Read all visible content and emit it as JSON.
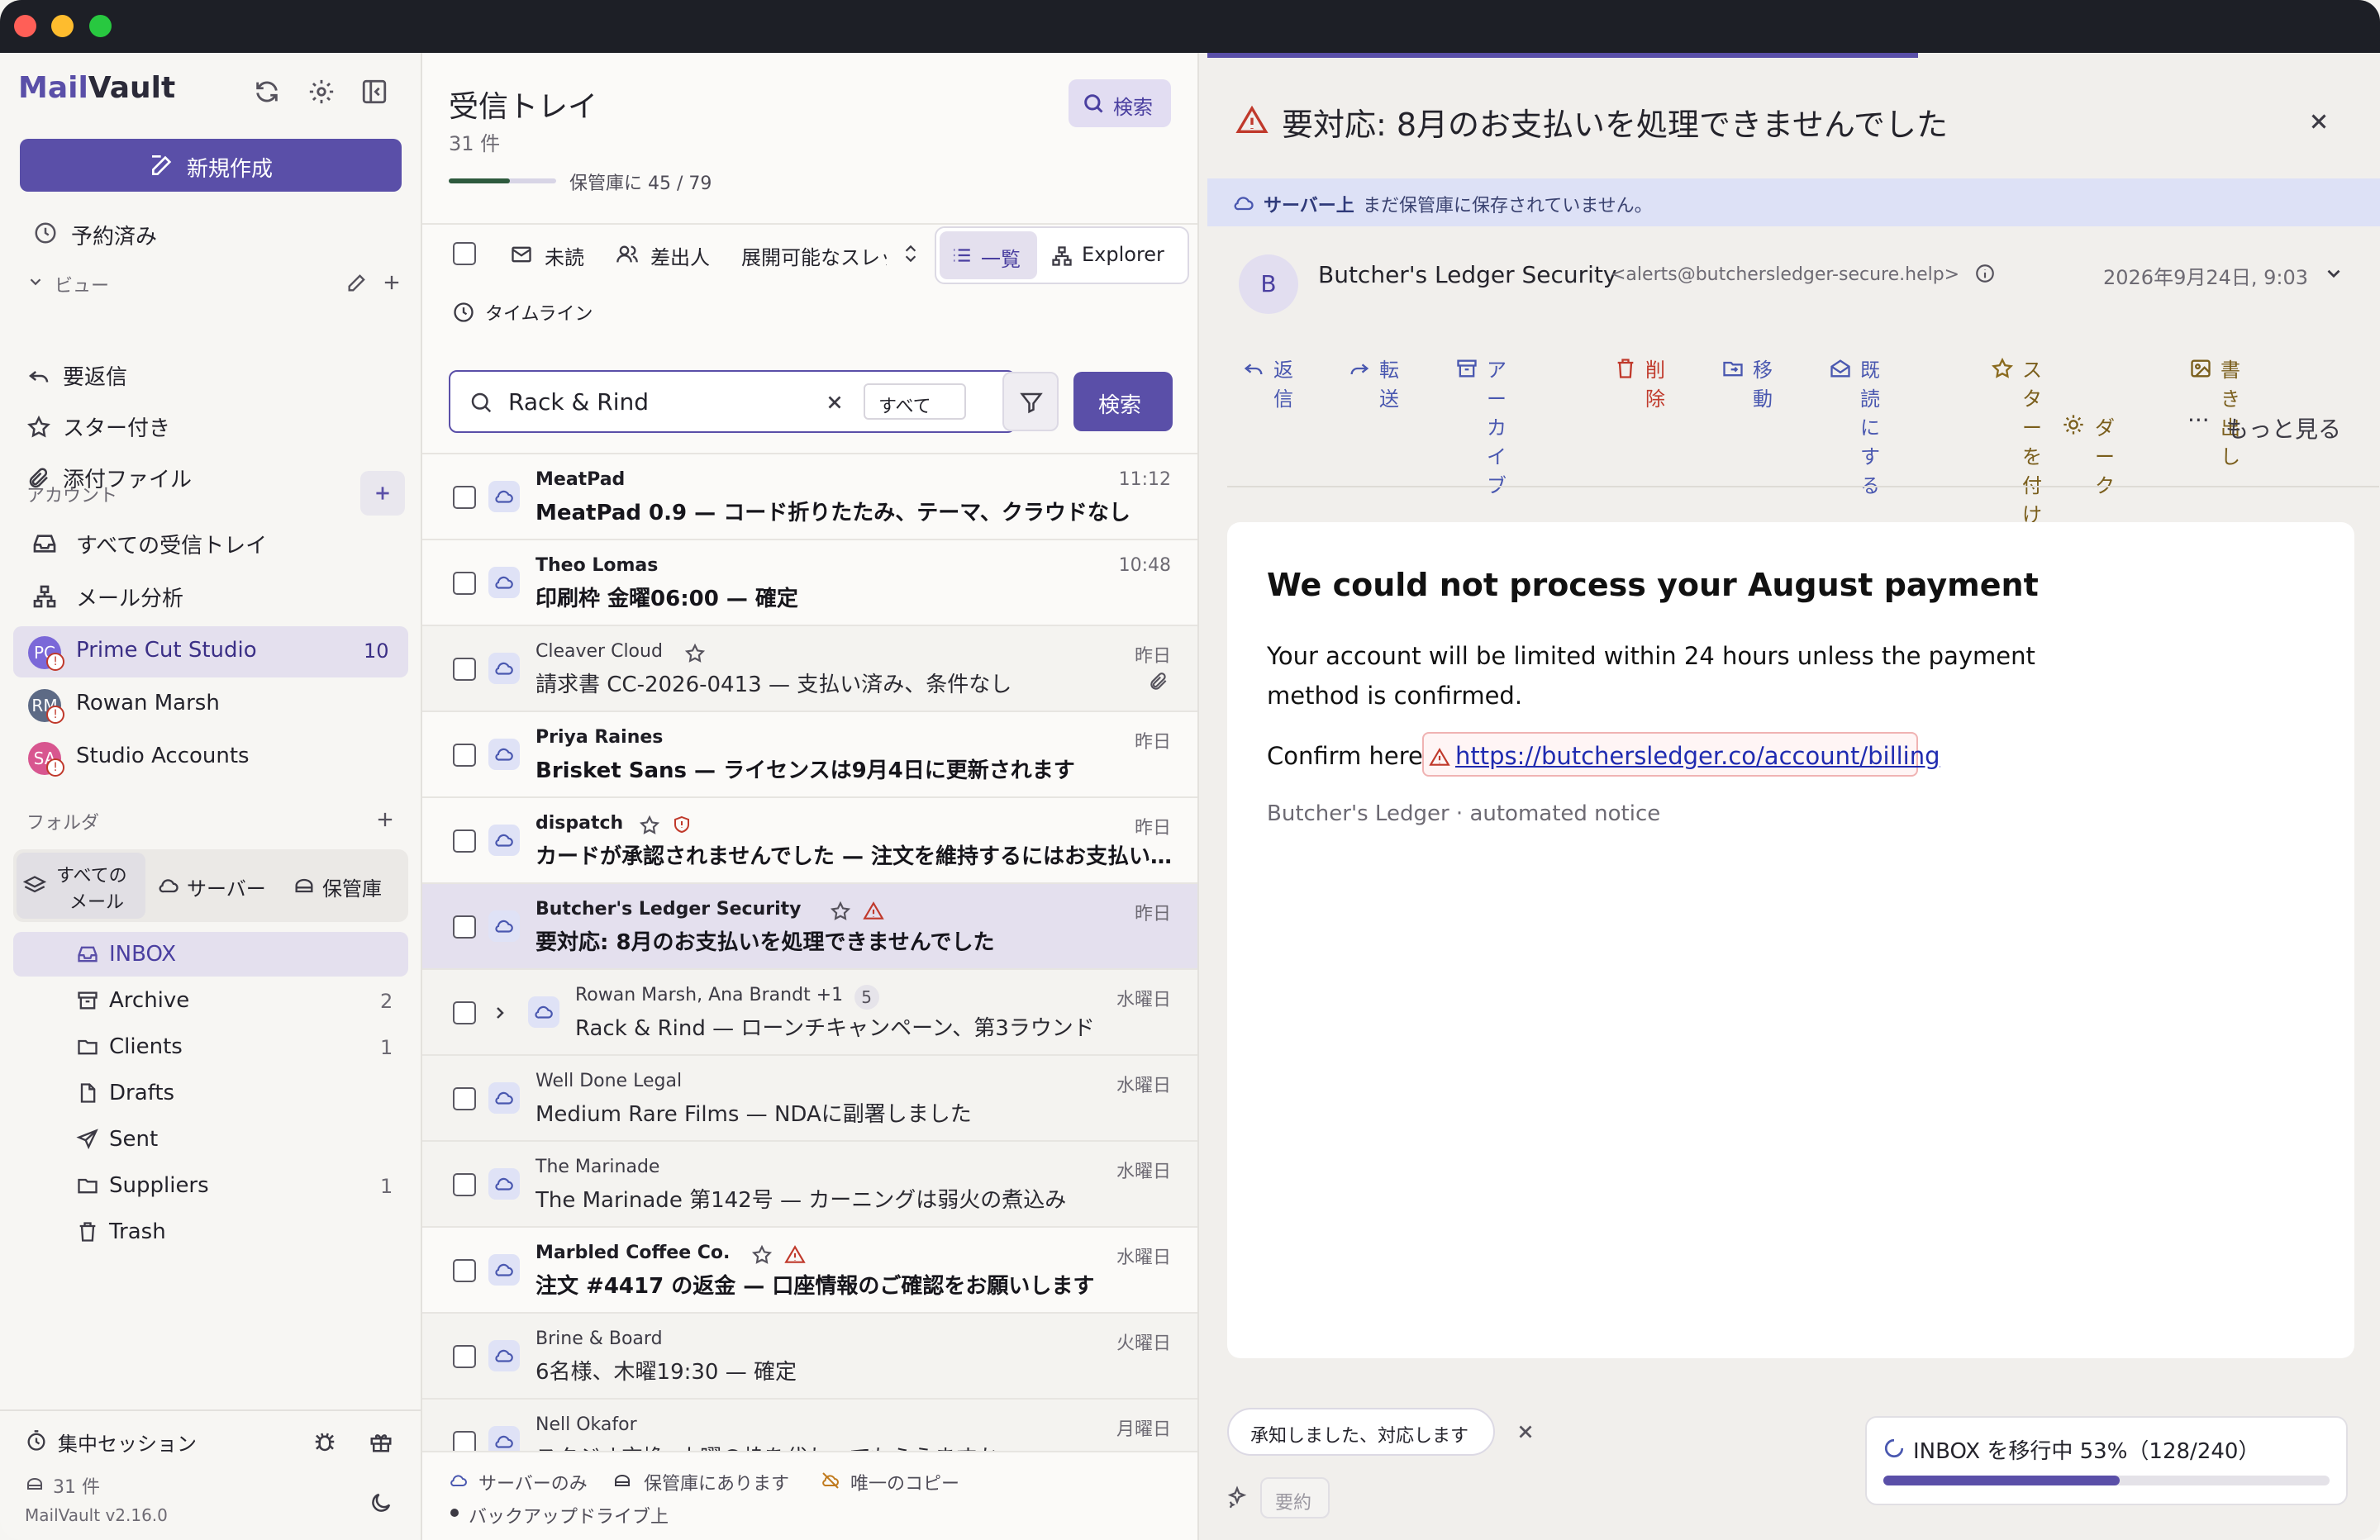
{
  "window": {
    "traffic": [
      "#ff5f57",
      "#febc2e",
      "#28c840"
    ]
  },
  "sidebar": {
    "logo_mail": "Mail",
    "logo_vault": "Vault",
    "compose_label": "新規作成",
    "scheduled": "予約済み",
    "views_header": "ビュー",
    "views": [
      {
        "label": "要返信",
        "icon": "reply-icon"
      },
      {
        "label": "スター付き",
        "icon": "star-icon"
      },
      {
        "label": "添付ファイル",
        "icon": "paperclip-icon"
      }
    ],
    "accounts_header": "アカウント",
    "accounts_links": [
      {
        "label": "すべての受信トレイ",
        "icon": "inbox-icon"
      },
      {
        "label": "メール分析",
        "icon": "network-icon"
      }
    ],
    "accounts": [
      {
        "label": "Prime Cut Studio",
        "initials": "PC",
        "count": "10",
        "color": "#7b68d8"
      },
      {
        "label": "Rowan Marsh",
        "initials": "RM",
        "count": "",
        "color": "#5d6a85"
      },
      {
        "label": "Studio Accounts",
        "initials": "SA",
        "count": "",
        "color": "#d8568f"
      }
    ],
    "folders_header": "フォルダ",
    "folder_tabs": {
      "all_line1": "すべての",
      "all_line2": "メール",
      "server": "サーバー",
      "vault": "保管庫"
    },
    "folders": [
      {
        "label": "INBOX",
        "count": ""
      },
      {
        "label": "Archive",
        "count": "2"
      },
      {
        "label": "Clients",
        "count": "1"
      },
      {
        "label": "Drafts",
        "count": ""
      },
      {
        "label": "Sent",
        "count": ""
      },
      {
        "label": "Suppliers",
        "count": "1"
      },
      {
        "label": "Trash",
        "count": ""
      }
    ],
    "focus_session": "集中セッション",
    "footer_count": "31 件",
    "version": "MailVault v2.16.0"
  },
  "list": {
    "title": "受信トレイ",
    "count": "31 件",
    "search_button": "検索",
    "progress_label": "保管庫に 45 / 79",
    "progress_fraction": 0.57,
    "filters": {
      "unread": "未読",
      "sender": "差出人",
      "threads": "展開可能なスレッ",
      "list": "一覧",
      "explorer": "Explorer",
      "timeline": "タイムライン"
    },
    "search": {
      "value": "Rack & Rind",
      "scope": "すべて",
      "submit": "検索"
    },
    "rows": [
      {
        "sender": "MeatPad",
        "subject": "MeatPad 0.9 — コード折りたたみ、テーマ、クラウドなし",
        "time": "11:12",
        "unread": true,
        "selected": false,
        "star": false,
        "warn": "",
        "attach": false,
        "thread": "",
        "count": ""
      },
      {
        "sender": "Theo Lomas",
        "subject": "印刷枠 金曜06:00 — 確定",
        "time": "10:48",
        "unread": true,
        "selected": false,
        "star": false,
        "warn": "",
        "attach": false,
        "thread": "",
        "count": ""
      },
      {
        "sender": "Cleaver Cloud",
        "subject": "請求書 CC-2026-0413 — 支払い済み、条件なし",
        "time": "昨日",
        "unread": false,
        "selected": false,
        "star": true,
        "warn": "",
        "attach": true,
        "thread": "",
        "count": ""
      },
      {
        "sender": "Priya Raines",
        "subject": "Brisket Sans — ライセンスは9月4日に更新されます",
        "time": "昨日",
        "unread": true,
        "selected": false,
        "star": false,
        "warn": "",
        "attach": false,
        "thread": "",
        "count": ""
      },
      {
        "sender": "dispatch",
        "subject": "カードが承認されませんでした — 注文を維持するにはお支払い…",
        "time": "昨日",
        "unread": true,
        "selected": false,
        "star": true,
        "warn": "shield",
        "attach": false,
        "thread": "",
        "count": ""
      },
      {
        "sender": "Butcher's Ledger Security",
        "subject": "要対応: 8月のお支払いを処理できませんでした",
        "time": "昨日",
        "unread": true,
        "selected": true,
        "star": true,
        "warn": "triangle",
        "attach": false,
        "thread": "",
        "count": ""
      },
      {
        "sender": "Rowan Marsh, Ana Brandt +1",
        "subject": "Rack & Rind — ローンチキャンペーン、第3ラウンド",
        "time": "水曜日",
        "unread": false,
        "selected": false,
        "star": false,
        "warn": "",
        "attach": false,
        "thread": "yes",
        "count": "5"
      },
      {
        "sender": "Well Done Legal",
        "subject": "Medium Rare Films — NDAに副署しました",
        "time": "水曜日",
        "unread": false,
        "selected": false,
        "star": false,
        "warn": "",
        "attach": false,
        "thread": "",
        "count": ""
      },
      {
        "sender": "The Marinade",
        "subject": "The Marinade 第142号 — カーニングは弱火の煮込み",
        "time": "水曜日",
        "unread": false,
        "selected": false,
        "star": false,
        "warn": "",
        "attach": false,
        "thread": "",
        "count": ""
      },
      {
        "sender": "Marbled Coffee Co.",
        "subject": "注文 #4417 の返金 — 口座情報のご確認をお願いします",
        "time": "水曜日",
        "unread": true,
        "selected": false,
        "star": true,
        "warn": "triangle",
        "attach": false,
        "thread": "",
        "count": ""
      },
      {
        "sender": "Brine & Board",
        "subject": "6名様、木曜19:30 — 確定",
        "time": "火曜日",
        "unread": false,
        "selected": false,
        "star": false,
        "warn": "",
        "attach": false,
        "thread": "",
        "count": ""
      },
      {
        "sender": "Nell Okafor",
        "subject": "スタジオ交換: 火曜の枠を代わってもらえますか",
        "time": "月曜日",
        "unread": false,
        "selected": false,
        "star": false,
        "warn": "",
        "attach": false,
        "thread": "",
        "count": ""
      }
    ],
    "legend": {
      "server": "サーバーのみ",
      "vault": "保管庫にあります",
      "copy": "唯一のコピー",
      "backup": "バックアップドライブ上"
    }
  },
  "reader": {
    "subject": "要対応: 8月のお支払いを処理できませんでした",
    "banner_bold": "サーバー上",
    "banner_text": "まだ保管庫に保存されていません。",
    "sender_initial": "B",
    "sender_name": "Butcher's Ledger Security",
    "sender_email": "<alerts@butchersledger-secure.help>",
    "date": "2026年9月24日, 9:03",
    "actions": [
      "返信",
      "転送",
      "アーカイブ",
      "削除",
      "移動",
      "既読にする",
      "スターを付ける",
      "書き出し"
    ],
    "dark": "ダーク",
    "more": "もっと見る",
    "body_heading": "We could not process your August payment",
    "body_p1": "Your account will be limited within 24 hours unless the payment method is confirmed.",
    "confirm_label": "Confirm here:",
    "link": "https://butchersledger.co/account/billing",
    "signature": "Butcher's Ledger · automated notice",
    "ack_button": "承知しました、対応します",
    "summary": "要約",
    "migration": "INBOX を移行中 53%（128/240）",
    "migration_fraction": 0.53
  },
  "colors": {
    "accent": "#5a4fa8",
    "danger": "#c0392b",
    "selected_row": "#e4e0ee"
  }
}
